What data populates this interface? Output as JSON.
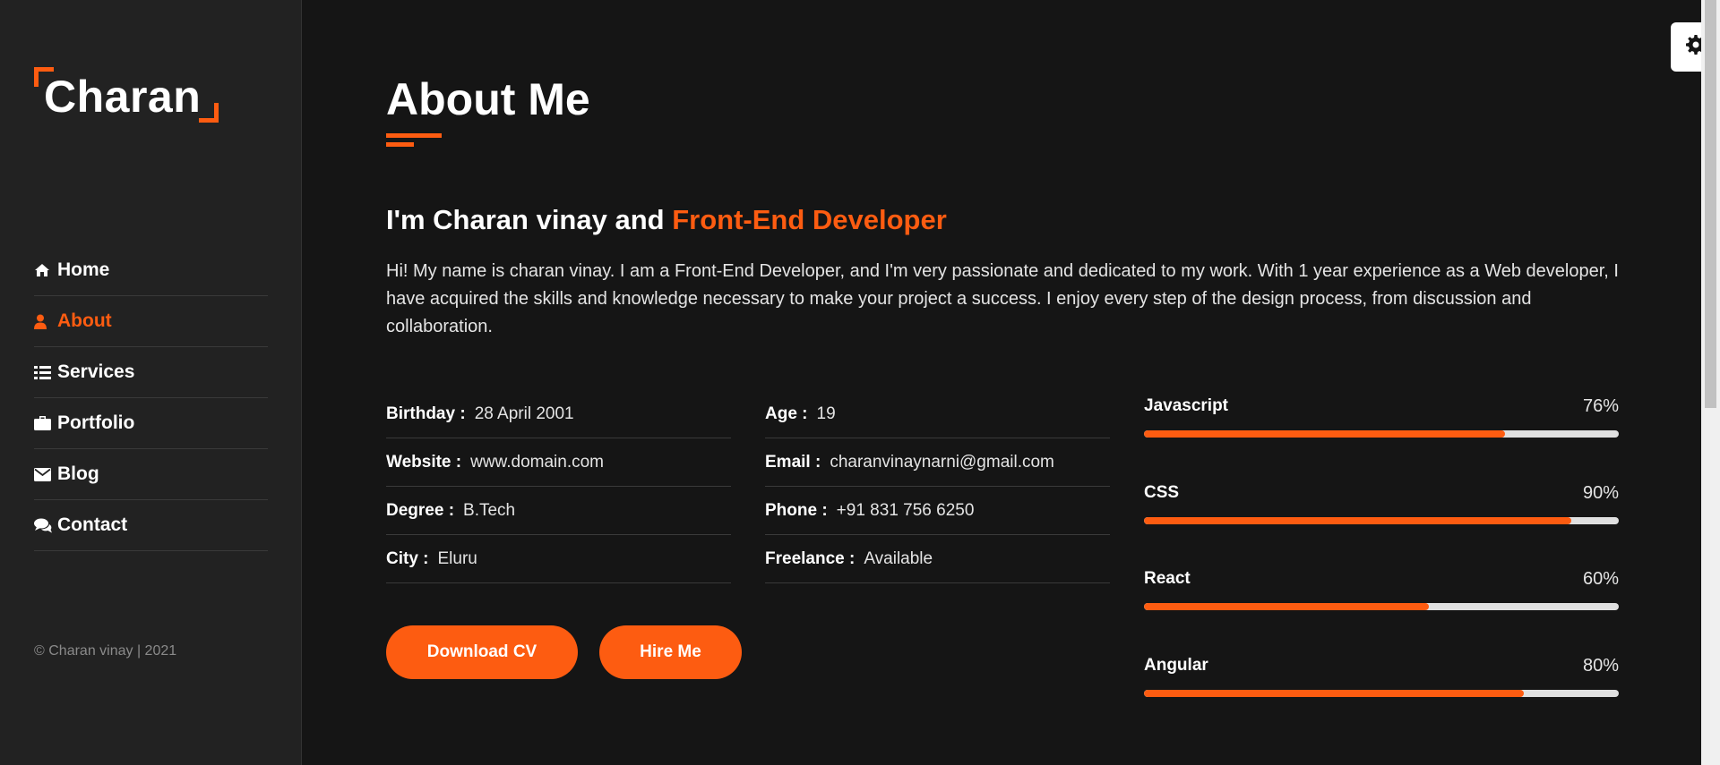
{
  "brand": {
    "logo_text": "Charan",
    "accent_color": "#fd5c11",
    "bg_color": "#151515",
    "sidebar_color": "#222222"
  },
  "nav": {
    "items": [
      {
        "label": "Home",
        "icon": "home-icon",
        "active": false
      },
      {
        "label": "About",
        "icon": "user-icon",
        "active": true
      },
      {
        "label": "Services",
        "icon": "list-icon",
        "active": false
      },
      {
        "label": "Portfolio",
        "icon": "briefcase-icon",
        "active": false
      },
      {
        "label": "Blog",
        "icon": "envelope-icon",
        "active": false
      },
      {
        "label": "Contact",
        "icon": "comments-icon",
        "active": false
      }
    ]
  },
  "footer": {
    "copyright": "© Charan vinay | 2021"
  },
  "about": {
    "title": "About Me",
    "intro_prefix": "I'm Charan vinay and ",
    "intro_accent": "Front-End Developer",
    "bio": "Hi! My name is charan vinay. I am a Front-End Developer, and I'm very passionate and dedicated to my work. With 1 year experience as a Web developer, I have acquired the skills and knowledge necessary to make your project a success. I enjoy every step of the design process, from discussion and collaboration."
  },
  "info_left": [
    {
      "label": "Birthday :",
      "value": "28 April 2001"
    },
    {
      "label": "Website :",
      "value": "www.domain.com"
    },
    {
      "label": "Degree :",
      "value": "B.Tech"
    },
    {
      "label": "City :",
      "value": "Eluru"
    }
  ],
  "info_right": [
    {
      "label": "Age :",
      "value": "19"
    },
    {
      "label": "Email :",
      "value": "charanvinaynarni@gmail.com"
    },
    {
      "label": "Phone :",
      "value": "+91 831 756 6250"
    },
    {
      "label": "Freelance :",
      "value": "Available"
    }
  ],
  "buttons": {
    "download_cv": "Download CV",
    "hire_me": "Hire Me"
  },
  "skills": [
    {
      "name": "Javascript",
      "percent_label": "76%",
      "value": 0.76
    },
    {
      "name": "CSS",
      "percent_label": "90%",
      "value": 0.9
    },
    {
      "name": "React",
      "percent_label": "60%",
      "value": 0.6
    },
    {
      "name": "Angular",
      "percent_label": "80%",
      "value": 0.8
    }
  ],
  "settings": {
    "icon": "gear-icon"
  }
}
